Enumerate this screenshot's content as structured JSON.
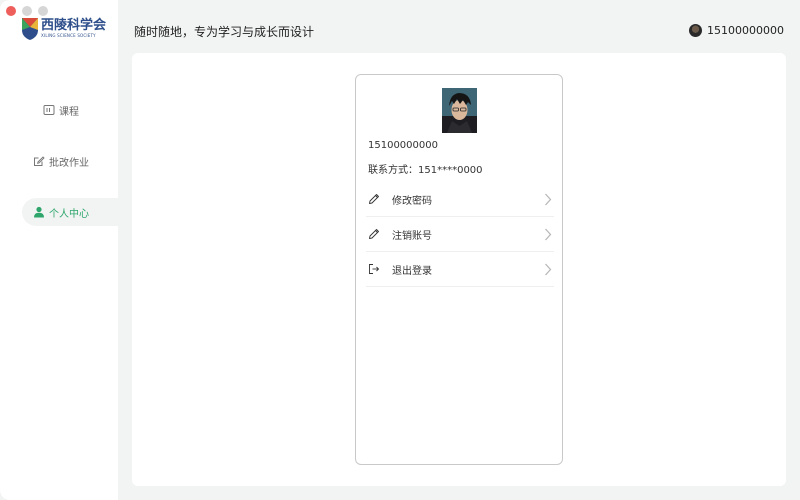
{
  "window": {
    "controls": [
      "close",
      "minimize",
      "maximize"
    ]
  },
  "logo": {
    "name_cn": "西陵科学会",
    "name_en": "XILING SCIENCE SOCIETY",
    "icon": "shield-logo-icon"
  },
  "sidebar": {
    "items": [
      {
        "label": "课程",
        "icon": "course-icon",
        "active": false
      },
      {
        "label": "批改作业",
        "icon": "edit-icon",
        "active": false
      },
      {
        "label": "个人中心",
        "icon": "user-icon",
        "active": true
      }
    ]
  },
  "header": {
    "slogan": "随时随地，专为学习与成长而设计",
    "username": "15100000000"
  },
  "profile": {
    "name": "15100000000",
    "contact_label": "联系方式：",
    "contact_value": "151****0000",
    "menu": [
      {
        "label": "修改密码",
        "icon": "pencil-icon"
      },
      {
        "label": "注销账号",
        "icon": "pencil-icon"
      },
      {
        "label": "退出登录",
        "icon": "logout-icon"
      }
    ]
  },
  "colors": {
    "accent": "#2ea56b",
    "brand_blue": "#2d4e8a",
    "background": "#f2f4f3"
  }
}
